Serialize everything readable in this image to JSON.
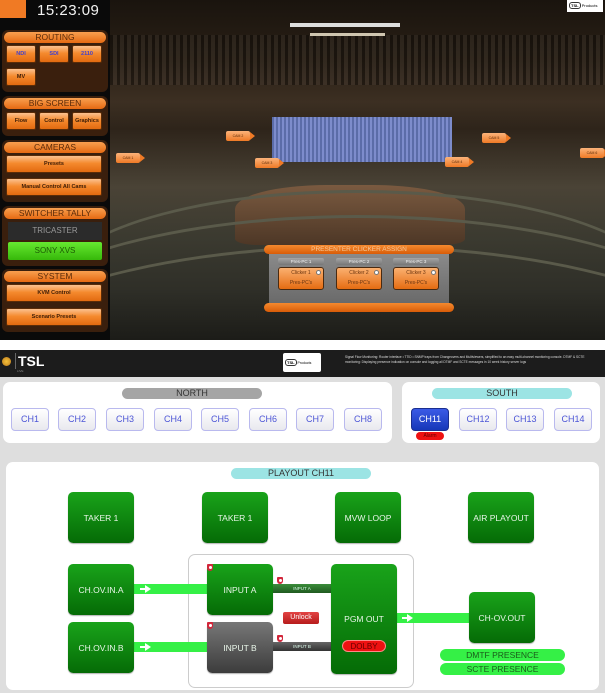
{
  "top_app": {
    "clock": "15:23:09",
    "groups": [
      {
        "title": "ROUTING",
        "buttons": [
          "NDI",
          "SDI",
          "2110",
          "MV"
        ]
      },
      {
        "title": "BIG SCREEN",
        "buttons": [
          "Flow",
          "Control",
          "Graphics"
        ]
      },
      {
        "title": "CAMERAS",
        "buttons": [
          "Presets",
          "Manual Control All Cams"
        ]
      },
      {
        "title": "SWITCHER TALLY",
        "tally": [
          {
            "label": "TRICASTER",
            "state": "off"
          },
          {
            "label": "SONY XVS",
            "state": "on"
          }
        ]
      },
      {
        "title": "SYSTEM",
        "buttons": [
          "KVM Control",
          "Scenario Presets"
        ]
      }
    ],
    "cameras": [
      "CAM 1",
      "CAM 2",
      "CAM 3",
      "CAM 4",
      "CAM 5",
      "CAM 6"
    ],
    "tsl_badge": {
      "logo": "TSL",
      "label": "Products"
    },
    "clicker": {
      "title": "PRESENTER CLICKER ASSIGN",
      "slots": [
        {
          "pc": "Pres-PC 1",
          "clicker": "Clicker 1",
          "sub": "Pres-PC's"
        },
        {
          "pc": "Pres-PC 2",
          "clicker": "Clicker 2",
          "sub": "Pres-PC's"
        },
        {
          "pc": "Pres-PC 3",
          "clicker": "Clicker 3",
          "sub": "Pres-PC's"
        }
      ]
    }
  },
  "bottom_app": {
    "header": {
      "brand": "TSL",
      "brand_sub": "LIVE",
      "products_logo": "TSL",
      "products_label": "Products",
      "description": "Signal Flow Monitoring: Router interface • TTID • SNMP traps from Changeovers and Multiviewers, simplified to an easy multi-channel monitoring console. DTMF & SCTE monitoring: Displaying presence indication on console and logging all DTMF and SCTE messages in 10 week history server logs"
    },
    "north": {
      "title": "NORTH",
      "channels": [
        "CH1",
        "CH2",
        "CH3",
        "CH4",
        "CH5",
        "CH6",
        "CH7",
        "CH8"
      ]
    },
    "south": {
      "title": "SOUTH",
      "channels": [
        "CH11",
        "CH12",
        "CH13",
        "CH14"
      ],
      "active": "CH11",
      "alarm_label": "Alarm"
    },
    "playout": {
      "title": "PLAYOUT CH11",
      "top_boxes": [
        "TAKER 1",
        "TAKER 1",
        "MVW LOOP",
        "AIR PLAYOUT"
      ],
      "source_a": "CH.OV.IN.A",
      "source_b": "CH.OV.IN.B",
      "input_a": "INPUT A",
      "input_b": "INPUT B",
      "route_a": "INPUT A",
      "route_b": "INPUT B",
      "unlock": "Unlock",
      "pgm_out": "PGM OUT",
      "dolby": "DOLBY",
      "output": "CH-OV.OUT",
      "presence": [
        "DMTF PRESENCE",
        "SCTE PRESENCE"
      ]
    }
  }
}
